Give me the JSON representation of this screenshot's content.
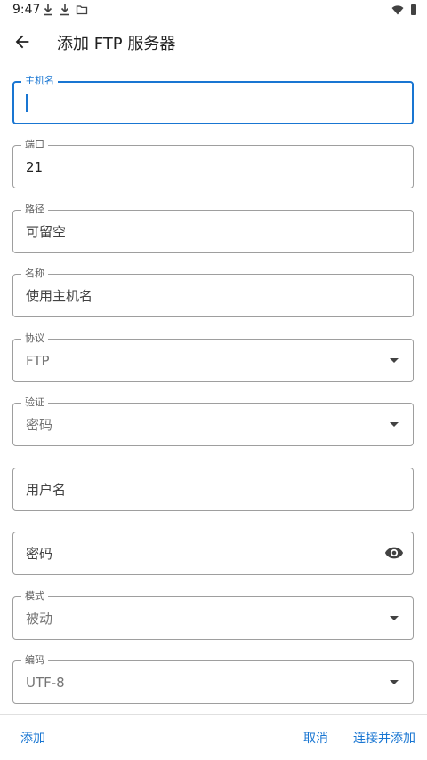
{
  "status_bar": {
    "time": "9:47",
    "icons": [
      "download-icon",
      "download-icon",
      "folder-icon",
      "wifi-icon",
      "battery-icon"
    ]
  },
  "app_bar": {
    "title": "添加 FTP 服务器",
    "back_icon": "arrow-back-icon"
  },
  "form": {
    "host": {
      "label": "主机名",
      "value": ""
    },
    "port": {
      "label": "端口",
      "value": "21"
    },
    "path": {
      "label": "路径",
      "placeholder": "可留空"
    },
    "name": {
      "label": "名称",
      "placeholder": "使用主机名"
    },
    "protocol": {
      "label": "协议",
      "value": "FTP"
    },
    "auth": {
      "label": "验证",
      "value": "密码"
    },
    "username": {
      "placeholder": "用户名"
    },
    "password": {
      "placeholder": "密码",
      "toggle_icon": "eye-icon"
    },
    "mode": {
      "label": "模式",
      "value": "被动"
    },
    "encoding": {
      "label": "编码",
      "value": "UTF-8"
    }
  },
  "actions": {
    "add": "添加",
    "cancel": "取消",
    "connect_and_add": "连接并添加"
  },
  "colors": {
    "accent": "#1976d2",
    "outline": "#9e9e9e"
  }
}
